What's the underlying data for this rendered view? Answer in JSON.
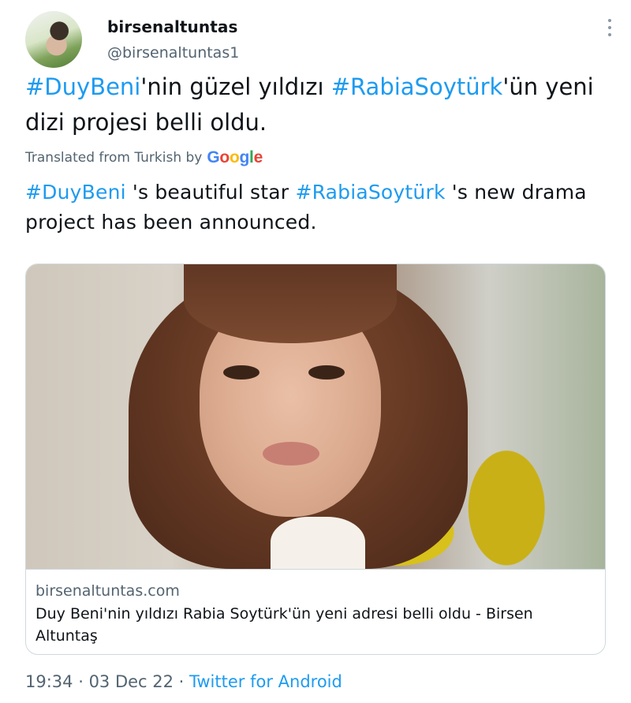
{
  "author": {
    "display_name": "birsenaltuntas",
    "handle": "@birsenaltuntas1"
  },
  "tweet": {
    "original": {
      "hashtag1": "#DuyBeni",
      "text1": "'nin güzel yıldızı ",
      "hashtag2": "#RabiaSoytürk",
      "text2": "'ün yeni dizi projesi belli oldu."
    },
    "translation_label": "Translated from Turkish by",
    "translation_provider": "Google",
    "translation": {
      "hashtag1": "#DuyBeni",
      "text1": " 's beautiful star ",
      "hashtag2": "#RabiaSoytürk",
      "text2": " 's new drama project has been announced."
    }
  },
  "link_card": {
    "domain": "birsenaltuntas.com",
    "title": "Duy Beni'nin yıldızı Rabia Soytürk'ün yeni adresi belli oldu - Birsen Altuntaş"
  },
  "footer": {
    "time": "19:34",
    "separator1": " · ",
    "date": "03 Dec 22",
    "separator2": " · ",
    "source": "Twitter for Android"
  },
  "colors": {
    "link": "#1d9bf0",
    "secondary_text": "#536471",
    "primary_text": "#0f1419"
  },
  "icons": {
    "more": "more-options-icon",
    "avatar": "profile-avatar"
  }
}
